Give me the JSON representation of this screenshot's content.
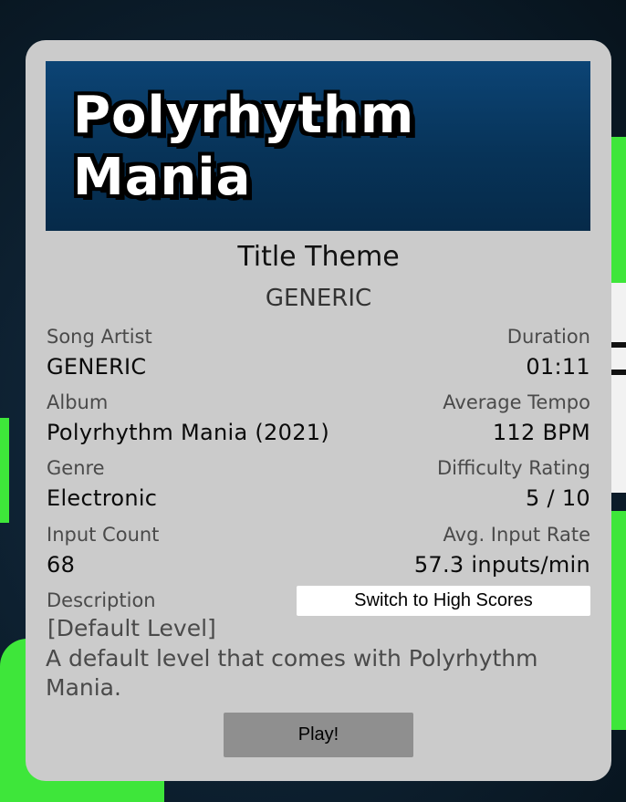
{
  "banner": {
    "logo_line1": "Polyrhythm",
    "logo_line2": "Mania"
  },
  "song": {
    "title": "Title Theme",
    "subtitle": "GENERIC"
  },
  "fields": {
    "song_artist": {
      "label": "Song Artist",
      "value": "GENERIC"
    },
    "duration": {
      "label": "Duration",
      "value": "01:11"
    },
    "album": {
      "label": "Album",
      "value": "Polyrhythm Mania (2021)"
    },
    "average_tempo": {
      "label": "Average Tempo",
      "value": "112 BPM"
    },
    "genre": {
      "label": "Genre",
      "value": "Electronic"
    },
    "difficulty_rating": {
      "label": "Difficulty Rating",
      "value": "5 / 10"
    },
    "input_count": {
      "label": "Input Count",
      "value": "68"
    },
    "avg_input_rate": {
      "label": "Avg. Input Rate",
      "value": "57.3 inputs/min"
    }
  },
  "description": {
    "label": "Description",
    "tag": "[Default Level]",
    "text": "A default level that comes with Polyrhythm Mania."
  },
  "buttons": {
    "switch": "Switch to High Scores",
    "play": "Play!"
  },
  "colors": {
    "card_bg": "#cbcbcb",
    "banner_bg": "#073358",
    "accent_green": "#3ee63a"
  }
}
